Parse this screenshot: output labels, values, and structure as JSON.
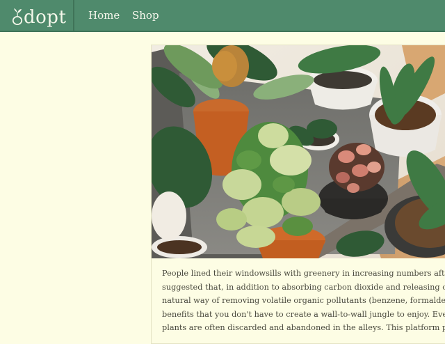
{
  "nav": {
    "brand": "dopt",
    "links": [
      {
        "label": "Home"
      },
      {
        "label": "Shop"
      }
    ]
  },
  "colors": {
    "navbar": "#4f8a6c",
    "page_background": "#fdfde4",
    "text": "#4a4a3e"
  },
  "icons": {
    "brand_mark": "potted-seedling-o"
  },
  "article": {
    "image": "potted-houseplants-photo",
    "lines": [
      "People lined their windowsills with greenery in increasing numbers after",
      "suggested that, in addition to absorbing carbon dioxide and releasing oxyge",
      "natural way of removing volatile organic pollutants (benzene, formaldehyde, a",
      "benefits that you don't have to create a wall-to-wall jungle to enjoy. Even a mo",
      "plants are often discarded and abandoned in the alleys. This platform provides"
    ]
  }
}
